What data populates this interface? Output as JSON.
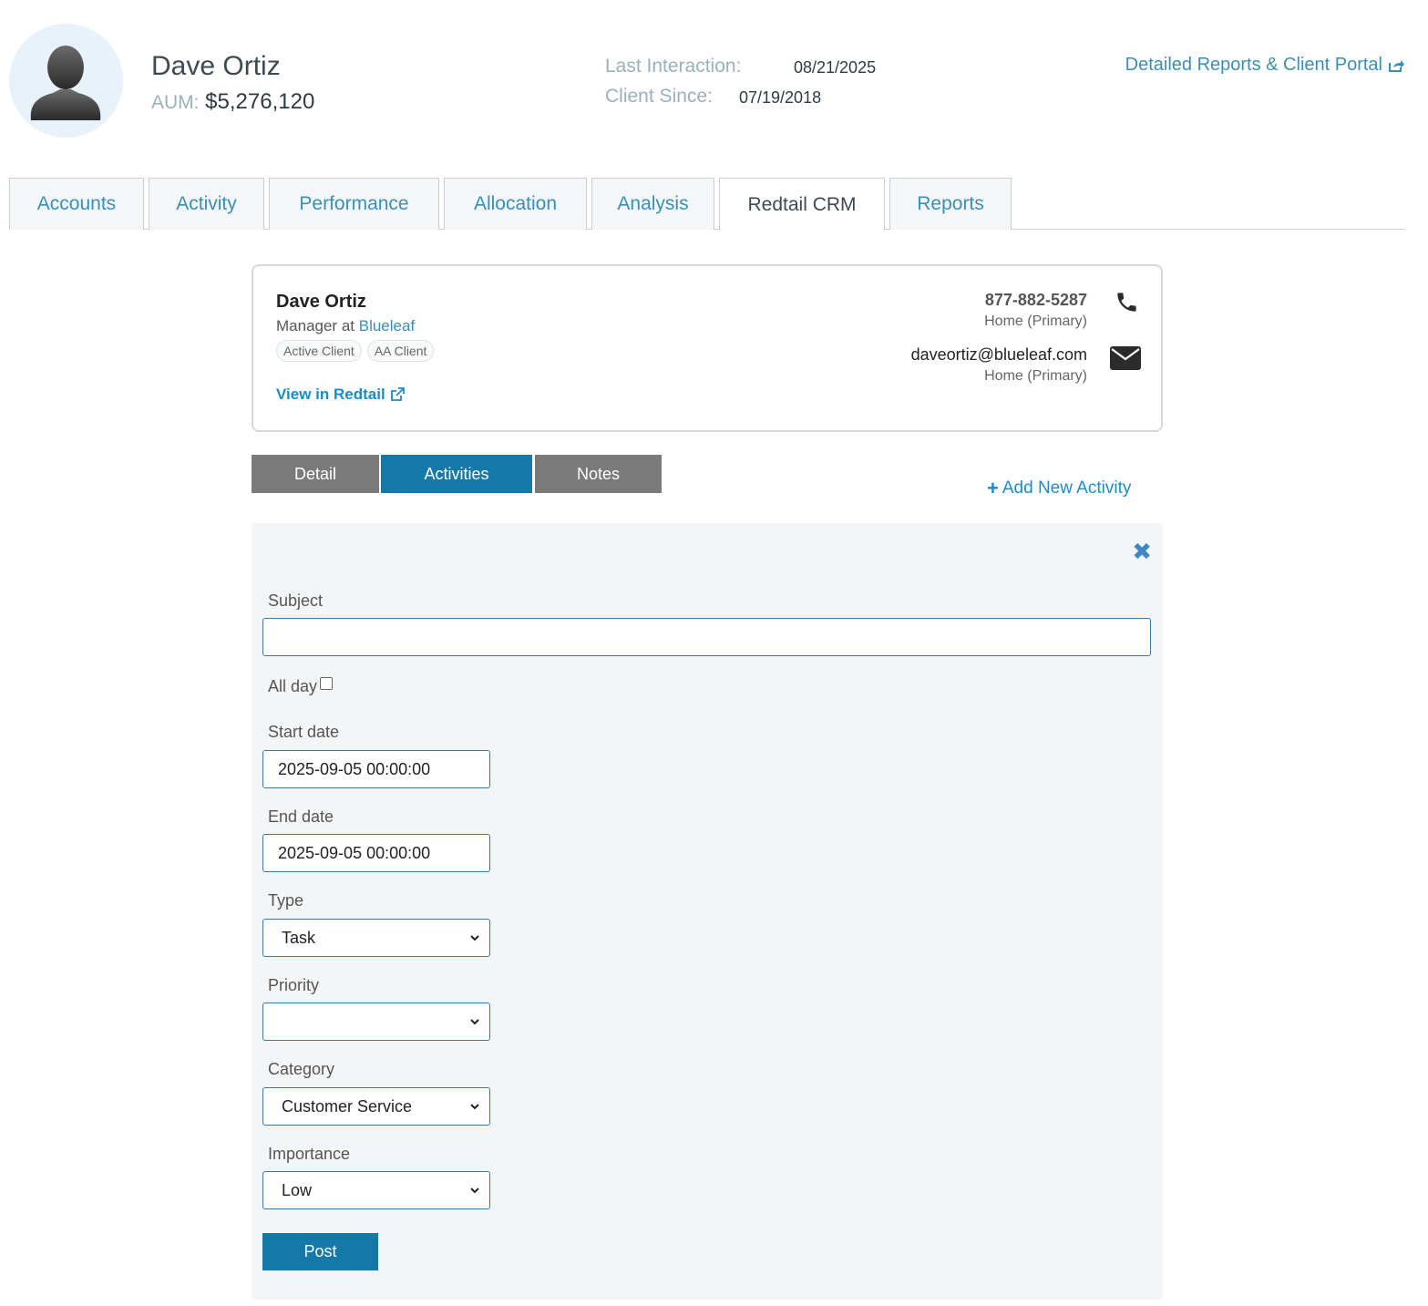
{
  "header": {
    "client_name": "Dave Ortiz",
    "aum_label": "AUM:",
    "aum_value": "$5,276,120",
    "last_interaction_label": "Last Interaction:",
    "last_interaction_value": "08/21/2025",
    "client_since_label": "Client Since:",
    "client_since_value": "07/19/2018",
    "portal_link": "Detailed Reports & Client Portal"
  },
  "tabs": [
    {
      "label": "Accounts"
    },
    {
      "label": "Activity"
    },
    {
      "label": "Performance"
    },
    {
      "label": "Allocation"
    },
    {
      "label": "Analysis"
    },
    {
      "label": "Redtail CRM",
      "active": true
    },
    {
      "label": "Reports"
    }
  ],
  "contact": {
    "name": "Dave Ortiz",
    "role_prefix": "Manager at ",
    "company": "Blueleaf",
    "badges": [
      "Active Client",
      "AA Client"
    ],
    "view_link": "View in Redtail",
    "phone": "877-882-5287",
    "phone_type": "Home (Primary)",
    "email": "daveortiz@blueleaf.com",
    "email_type": "Home (Primary)"
  },
  "subtabs": [
    {
      "label": "Detail",
      "active": false
    },
    {
      "label": "Activities",
      "active": true
    },
    {
      "label": "Notes",
      "active": false
    }
  ],
  "add_activity_label": "Add New Activity",
  "form": {
    "subject_label": "Subject",
    "subject_value": "",
    "all_day_label": "All day",
    "all_day_checked": false,
    "start_date_label": "Start date",
    "start_date_value": "2025-09-05 00:00:00",
    "end_date_label": "End date",
    "end_date_value": "2025-09-05 00:00:00",
    "type_label": "Type",
    "type_value": "Task",
    "priority_label": "Priority",
    "priority_value": "",
    "category_label": "Category",
    "category_value": "Customer Service",
    "importance_label": "Importance",
    "importance_value": "Low",
    "post_label": "Post"
  },
  "colors": {
    "accent": "#3a8fb7",
    "active_subtab": "#1478a8",
    "inactive_subtab": "#7a7a7a",
    "panel_bg": "#f3f5f6"
  },
  "icons": {
    "avatar": "user-silhouette-icon",
    "external": "external-link-icon",
    "phone": "phone-icon",
    "email": "envelope-icon",
    "close": "close-icon",
    "add": "plus-icon",
    "select": "chevron-down-icon"
  }
}
